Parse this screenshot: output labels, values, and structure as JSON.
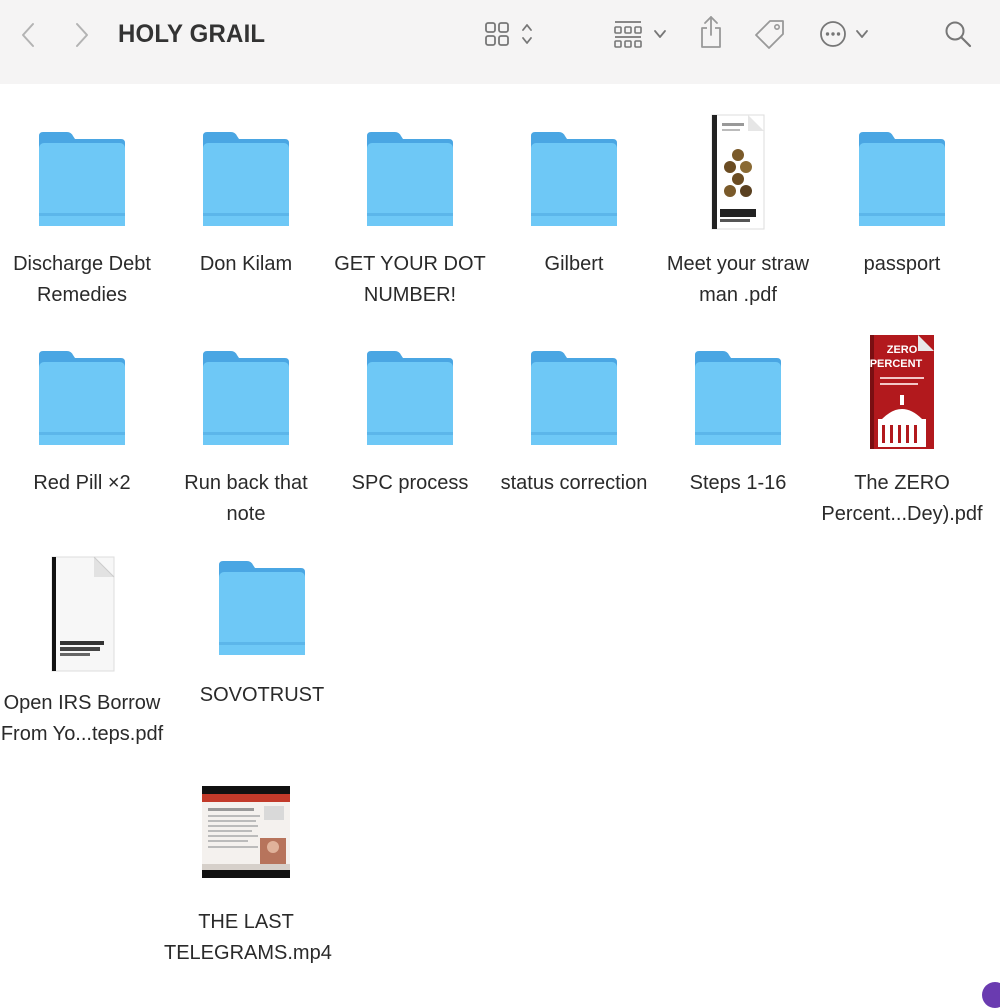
{
  "window": {
    "title": "HOLY GRAIL"
  },
  "toolbar": {
    "back": "chevron-left-icon",
    "forward": "chevron-right-icon",
    "view_mode": "grid-view-icon",
    "group": "group-by-icon",
    "share": "share-icon",
    "tags": "tag-icon",
    "more": "more-actions-icon",
    "search": "search-icon"
  },
  "colors": {
    "folder_body": "#6ec8f6",
    "folder_tab": "#4aa6e3",
    "toolbar_bg": "#f5f4f4"
  },
  "items": [
    {
      "label1": "Discharge Debt",
      "label2": "Remedies",
      "type": "folder"
    },
    {
      "label1": "Don Kilam",
      "label2": "",
      "type": "folder"
    },
    {
      "label1": "GET YOUR DOT",
      "label2": "NUMBER!",
      "type": "folder"
    },
    {
      "label1": "Gilbert",
      "label2": "",
      "type": "folder"
    },
    {
      "label1": "Meet your straw",
      "label2": "man .pdf",
      "type": "pdf"
    },
    {
      "label1": "passport",
      "label2": "",
      "type": "folder"
    },
    {
      "label1": "Red Pill ×2",
      "label2": "",
      "type": "folder"
    },
    {
      "label1": "Run back that",
      "label2": "note",
      "type": "folder"
    },
    {
      "label1": "SPC process",
      "label2": "",
      "type": "folder"
    },
    {
      "label1": "status correction",
      "label2": "",
      "type": "folder"
    },
    {
      "label1": "Steps 1-16",
      "label2": "",
      "type": "folder"
    },
    {
      "label1": "The ZERO",
      "label2": "Percent...Dey).pdf",
      "type": "pdf",
      "cover_text": "ZERO PERCENT"
    },
    {
      "label1": "Open IRS Borrow",
      "label2": "From Yo...teps.pdf",
      "type": "pdf"
    },
    {
      "label1": "SOVOTRUST",
      "label2": "",
      "type": "folder"
    },
    {
      "label1": "THE LAST",
      "label2": "TELEGRAMS.mp4",
      "type": "video"
    }
  ]
}
